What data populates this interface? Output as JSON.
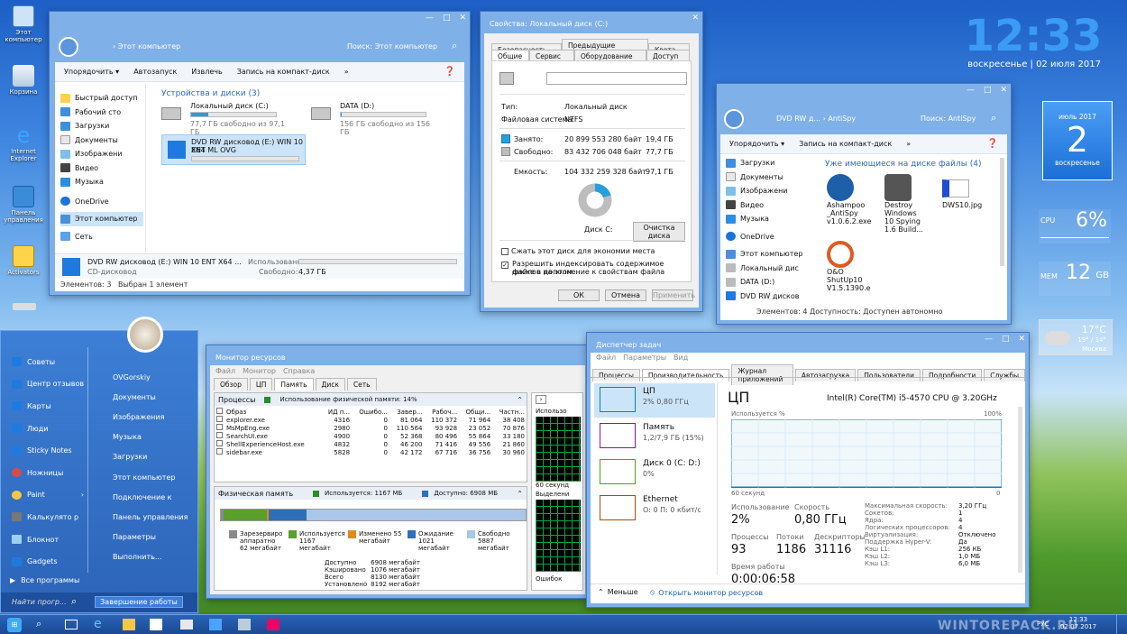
{
  "desktop": {
    "icons": [
      "Этот компьютер",
      "Корзина",
      "Internet Explorer",
      "Панель управления",
      "Activators"
    ]
  },
  "clock": {
    "time": "12:33",
    "date": "воскресенье | 02 июля 2017"
  },
  "calendar": {
    "month": "июль 2017",
    "day": "2",
    "weekday": "воскресенье"
  },
  "gadgets": {
    "cpu_label": "CPU",
    "cpu_value": "6%",
    "mem_label": "МЕМ",
    "mem_value": "12",
    "mem_unit": "GB",
    "weather_temp": "17°C",
    "weather_range": "19° / 14°",
    "weather_city": "Москва"
  },
  "explorer": {
    "breadcrumb": "›  Этот компьютер",
    "search": "Поиск: Этот компьютер",
    "toolbar": [
      "Упорядочить ▾",
      "Автозапуск",
      "Извлечь",
      "Запись на компакт-диск",
      "»"
    ],
    "nav": [
      "Быстрый доступ",
      "Рабочий сто",
      "Загрузки",
      "Документы",
      "Изображени",
      "Видео",
      "Музыка",
      "OneDrive",
      "Этот компьютер",
      "Сеть"
    ],
    "section": "Устройства и диски (3)",
    "drive_c": {
      "name": "Локальный диск (C:)",
      "free": "77,7 ГБ свободно из 97,1 ГБ",
      "fill": 0.2
    },
    "drive_d": {
      "name": "DATA (D:)",
      "free": "156 ГБ свободно из 156 ГБ",
      "fill": 0.01
    },
    "dvd": {
      "name1": "DVD RW дисковод (E:) WIN 10 ENT",
      "name2": "X64 ML OVG"
    },
    "details": {
      "name": "DVD RW дисковод (E:) WIN 10 ENT X64 ...",
      "type": "CD-дисковод",
      "used_label": "Использовано:",
      "free_label": "Свободно:",
      "free_value": "4,37 ГБ"
    },
    "status_count": "Элементов: 3",
    "status_sel": "Выбран 1 элемент"
  },
  "props": {
    "title": "Свойства: Локальный диск (C:)",
    "tabs_top": [
      "Безопасность",
      "Предыдущие версии",
      "Квота"
    ],
    "tabs_bot": [
      "Общие",
      "Сервис",
      "Оборудование",
      "Доступ"
    ],
    "type_label": "Тип:",
    "type_value": "Локальный диск",
    "fs_label": "Файловая система:",
    "fs_value": "NTFS",
    "used_label": "Занято:",
    "used_bytes": "20 899 553 280 байт",
    "used_gb": "19,4 ГБ",
    "free_label": "Свободно:",
    "free_bytes": "83 432 706 048 байт",
    "free_gb": "77,7 ГБ",
    "cap_label": "Емкость:",
    "cap_bytes": "104 332 259 328 байт",
    "cap_gb": "97,1 ГБ",
    "disk_label": "Диск C:",
    "cleanup": "Очистка диска",
    "cb1": "Сжать этот диск для экономии места",
    "cb2a": "Разрешить индексировать содержимое файлов на этом",
    "cb2b": "диске в дополнение к свойствам файла",
    "ok": "ОК",
    "cancel": "Отмена",
    "apply": "Применить",
    "used_fraction": 0.2
  },
  "antispy": {
    "breadcrumb": "DVD RW д...  ›  AntiSpy",
    "search": "Поиск: AntiSpy",
    "toolbar": [
      "Упорядочить ▾",
      "Запись на компакт-диск",
      "»"
    ],
    "nav": [
      "Загрузки",
      "Документы",
      "Изображени",
      "Видео",
      "Музыка",
      "OneDrive",
      "Этот компьютер",
      "Локальный дис",
      "DATA (D:)",
      "DVD RW дисков"
    ],
    "section": "Уже имеющиеся на диске файлы (4)",
    "files": [
      {
        "l1": "Ashampoo",
        "l2": "_AntiSpy",
        "l3": "v1.0.6.2.exe"
      },
      {
        "l1": "Destroy",
        "l2": "Windows",
        "l3": "10 Spying",
        "l4": "1.6 Build..."
      },
      {
        "l1": "DWS10.jpg"
      },
      {
        "l1": "O&O",
        "l2": "ShutUp10",
        "l3": "V1.5.1390.e"
      }
    ],
    "status": "Элементов: 4  Доступность:     Доступен автономно"
  },
  "start": {
    "user": "OVGorskiy",
    "left": [
      "Советы",
      "Центр отзывов",
      "Карты",
      "Люди",
      "Sticky Notes",
      "Ножницы",
      "Paint",
      "Калькулято р",
      "Блокнот",
      "Gadgets"
    ],
    "all_programs": "Все программы",
    "search": "Найти прогр...",
    "right": [
      "OVGorskiy",
      "Документы",
      "Изображения",
      "Музыка",
      "Загрузки",
      "Этот компьютер",
      "Подключение к",
      "Панель управления",
      "Параметры",
      "Выполнить..."
    ],
    "shutdown": "Завершение работы"
  },
  "resmon": {
    "title": "Монитор ресурсов",
    "menu": [
      "Файл",
      "Монитор",
      "Справка"
    ],
    "tabs": [
      "Обзор",
      "ЦП",
      "Память",
      "Диск",
      "Сеть"
    ],
    "proc_header": "Процессы",
    "proc_usage": "Использование физической памяти: 14%",
    "columns": [
      "Образ",
      "ИД п...",
      "Ошибо...",
      "Завер...",
      "Рабоч...",
      "Общи...",
      "Частн..."
    ],
    "rows": [
      [
        "explorer.exe",
        "4316",
        "0",
        "81 064",
        "110 372",
        "71 964",
        "38 408"
      ],
      [
        "MsMpEng.exe",
        "2980",
        "0",
        "110 564",
        "93 928",
        "23 052",
        "70 876"
      ],
      [
        "SearchUI.exe",
        "4900",
        "0",
        "52 368",
        "80 496",
        "55 864",
        "33 180"
      ],
      [
        "ShellExperienceHost.exe",
        "4832",
        "0",
        "46 200",
        "71 416",
        "49 556",
        "21 860"
      ],
      [
        "sidebar.exe",
        "5828",
        "0",
        "42 172",
        "67 716",
        "36 756",
        "30 960"
      ]
    ],
    "phys_header": "Физическая память",
    "phys_used": "Используется: 1167 МБ",
    "phys_avail": "Доступно: 6908 МБ",
    "legend": [
      {
        "t": "Зарезервиро аппаратно",
        "v": "62 мегабайт",
        "c": "#8a8a8a"
      },
      {
        "t": "Используется",
        "v": "1167 мегабайт",
        "c": "#5aa02c"
      },
      {
        "t": "Изменено",
        "v": "55 мегабайт",
        "c": "#e08a1e"
      },
      {
        "t": "Ожидание",
        "v": "1021 мегабайт",
        "c": "#2f6fb8"
      },
      {
        "t": "Свободно",
        "v": "5887 мегабайт",
        "c": "#a9c7e8"
      }
    ],
    "stats": [
      [
        "Доступно",
        "6908 мегабайт"
      ],
      [
        "Кэшировано",
        "1076 мегабайт"
      ],
      [
        "Всего",
        "8130 мегабайт"
      ],
      [
        "Установлено",
        "8192 мегабайт"
      ]
    ],
    "side": [
      "Использо",
      "60 секунд",
      "Выделени",
      "Ошибок"
    ]
  },
  "taskmgr": {
    "title": "Диспетчер задач",
    "menu": [
      "Файл",
      "Параметры",
      "Вид"
    ],
    "tabs": [
      "Процессы",
      "Производительность",
      "Журнал приложений",
      "Автозагрузка",
      "Пользователи",
      "Подробности",
      "Службы"
    ],
    "side": [
      {
        "name": "ЦП",
        "sub": "2% 0,80 ГГц",
        "color": "#117dbb"
      },
      {
        "name": "Память",
        "sub": "1,2/7,9 ГБ (15%)",
        "color": "#8b12ae"
      },
      {
        "name": "Диск 0 (C: D:)",
        "sub": "0%",
        "color": "#4da60c"
      },
      {
        "name": "Ethernet",
        "sub": "О: 0 П: 0 кбит/с",
        "color": "#a74f01"
      }
    ],
    "heading": "ЦП",
    "cpu_name": "Intel(R) Core(TM) i5-4570 CPU @ 3.20GHz",
    "graph_label": "Используется %",
    "graph_max": "100%",
    "graph_time": "60 секунд",
    "graph_min": "0",
    "usage_label": "Использование",
    "usage": "2%",
    "speed_label": "Скорость",
    "speed": "0,80 ГГц",
    "proc_label": "Процессы",
    "proc": "93",
    "thr_label": "Потоки",
    "thr": "1186",
    "hnd_label": "Дескрипторы",
    "hnd": "31116",
    "up_label": "Время работы",
    "uptime": "0:00:06:58",
    "specs": [
      [
        "Максимальная скорость:",
        "3,20 ГГц"
      ],
      [
        "Сокетов:",
        "1"
      ],
      [
        "Ядра:",
        "4"
      ],
      [
        "Логических процессоров:",
        "4"
      ],
      [
        "Виртуализация:",
        "Отключено"
      ],
      [
        "Поддержка Hyper-V:",
        "Да"
      ],
      [
        "Кэш L1:",
        "256 КБ"
      ],
      [
        "Кэш L2:",
        "1,0 МБ"
      ],
      [
        "Кэш L3:",
        "6,0 МБ"
      ]
    ],
    "less": "Меньше",
    "open_resmon": "Открыть монитор ресурсов"
  },
  "taskbar": {
    "time": "12:33",
    "date": "02.07.2017",
    "lang": "РУС",
    "watermark": "WINTOREPACK.RU"
  }
}
